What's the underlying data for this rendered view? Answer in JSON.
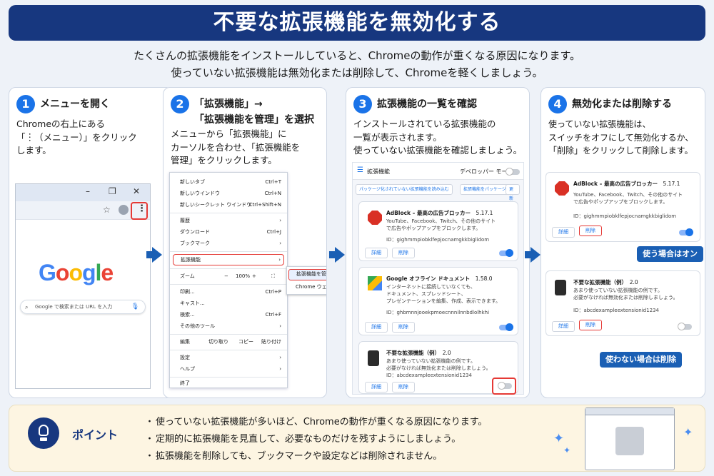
{
  "title": "不要な拡張機能を無効化する",
  "intro": [
    "たくさんの拡張機能をインストールしていると、Chromeの動作が重くなる原因になります。",
    "使っていない拡張機能は無効化または削除して、Chromeを軽くしましょう。"
  ],
  "steps": [
    {
      "num": "1",
      "title": "メニューを開く",
      "desc": [
        "Chromeの右上にある",
        "「︙（メニュー）」をクリック",
        "します。"
      ]
    },
    {
      "num": "2",
      "title": "「拡張機能」→",
      "title2": "「拡張機能を管理」を選択",
      "desc": [
        "メニューから「拡張機能」に",
        "カーソルを合わせ、「拡張機能を",
        "管理」をクリックします。"
      ]
    },
    {
      "num": "3",
      "title": "拡張機能の一覧を確認",
      "desc": [
        "インストールされている拡張機能の",
        "一覧が表示されます。",
        "使っていない拡張機能を確認しましょう。"
      ]
    },
    {
      "num": "4",
      "title": "無効化または削除する",
      "desc": [
        "使っていない拡張機能は、",
        "スイッチをオフにして無効化するか、",
        "「削除」をクリックして削除します。"
      ]
    }
  ],
  "browser": {
    "logo": "Google",
    "search_placeholder": "Google で検索または URL を入力",
    "controls": [
      "–",
      "❐",
      "✕"
    ]
  },
  "menu": {
    "items": [
      {
        "label": "新しいタブ",
        "shortcut": "Ctrl+T"
      },
      {
        "label": "新しいウインドウ",
        "shortcut": "Ctrl+N"
      },
      {
        "label": "新しいシークレット ウインドウ",
        "shortcut": "Ctrl+Shift+N"
      },
      {
        "label": "履歴",
        "shortcut": "›"
      },
      {
        "label": "ダウンロード",
        "shortcut": "Ctrl+J"
      },
      {
        "label": "ブックマーク",
        "shortcut": "›"
      },
      {
        "label": "拡張機能",
        "shortcut": "›"
      },
      {
        "label": "ズーム",
        "shortcut": ""
      },
      {
        "label": "印刷...",
        "shortcut": "Ctrl+P"
      },
      {
        "label": "キャスト...",
        "shortcut": ""
      },
      {
        "label": "検索...",
        "shortcut": "Ctrl+F"
      },
      {
        "label": "その他のツール",
        "shortcut": "›"
      },
      {
        "label": "編集",
        "shortcut": ""
      },
      {
        "label": "設定",
        "shortcut": "›"
      },
      {
        "label": "ヘルプ",
        "shortcut": "›"
      },
      {
        "label": "終了",
        "shortcut": ""
      }
    ],
    "zoom": {
      "minus": "−",
      "value": "100%",
      "plus": "+",
      "full": "⛶"
    },
    "edit": {
      "cut": "切り取り",
      "copy": "コピー",
      "paste": "貼り付け"
    },
    "submenu": [
      "拡張機能を管理",
      "Chrome ウェブストアを開く"
    ]
  },
  "ext_page": {
    "header": "拡張機能",
    "dev_mode": "デベロッパー モード",
    "load_btn": "パッケージ化されていない拡張機能を読み込む",
    "pack_btn": "拡張機能をパッケージ化",
    "update_btn": "更新",
    "detail": "詳細",
    "remove": "削除"
  },
  "extensions": [
    {
      "name": "AdBlock – 最高の広告ブロッカー",
      "version": "5.17.1",
      "desc": [
        "YouTube、Facebook、Twitch、その他のサイト",
        "で広告やポップアップをブロックします。"
      ],
      "id": "ID：gighmmpiobklfepjocnamgkkbiglidom",
      "enabled": true
    },
    {
      "name": "Google オフライン ドキュメント",
      "version": "1.58.0",
      "desc": [
        "インターネットに接続していなくても、",
        "ドキュメント、スプレッドシート、",
        "プレゼンテーションを編集、作成、表示できます。"
      ],
      "id": "ID：ghbmnnjooekpmoecnnnilnnbdlolhkhi",
      "enabled": true
    },
    {
      "name": "不要な拡張機能（例）",
      "version": "2.0",
      "desc": [
        "あまり使っていない拡張機能の例です。",
        "必要がなければ無効化または削除しましょう。"
      ],
      "id": "ID：abcdexampleextensionid1234",
      "enabled": false
    }
  ],
  "callouts": {
    "on": "使う場合はオン",
    "remove": "使わない場合は削除"
  },
  "point": {
    "label": "ポイント",
    "items": [
      "使っていない拡張機能が多いほど、Chromeの動作が重くなる原因になります。",
      "定期的に拡張機能を見直して、必要なものだけを残すようにしましょう。",
      "拡張機能を削除しても、ブックマークや設定などは削除されません。"
    ]
  },
  "colors": {
    "navy": "#17377f",
    "accent": "#1a73e8",
    "red": "#e53935",
    "point_bg": "#fdf5e2"
  }
}
